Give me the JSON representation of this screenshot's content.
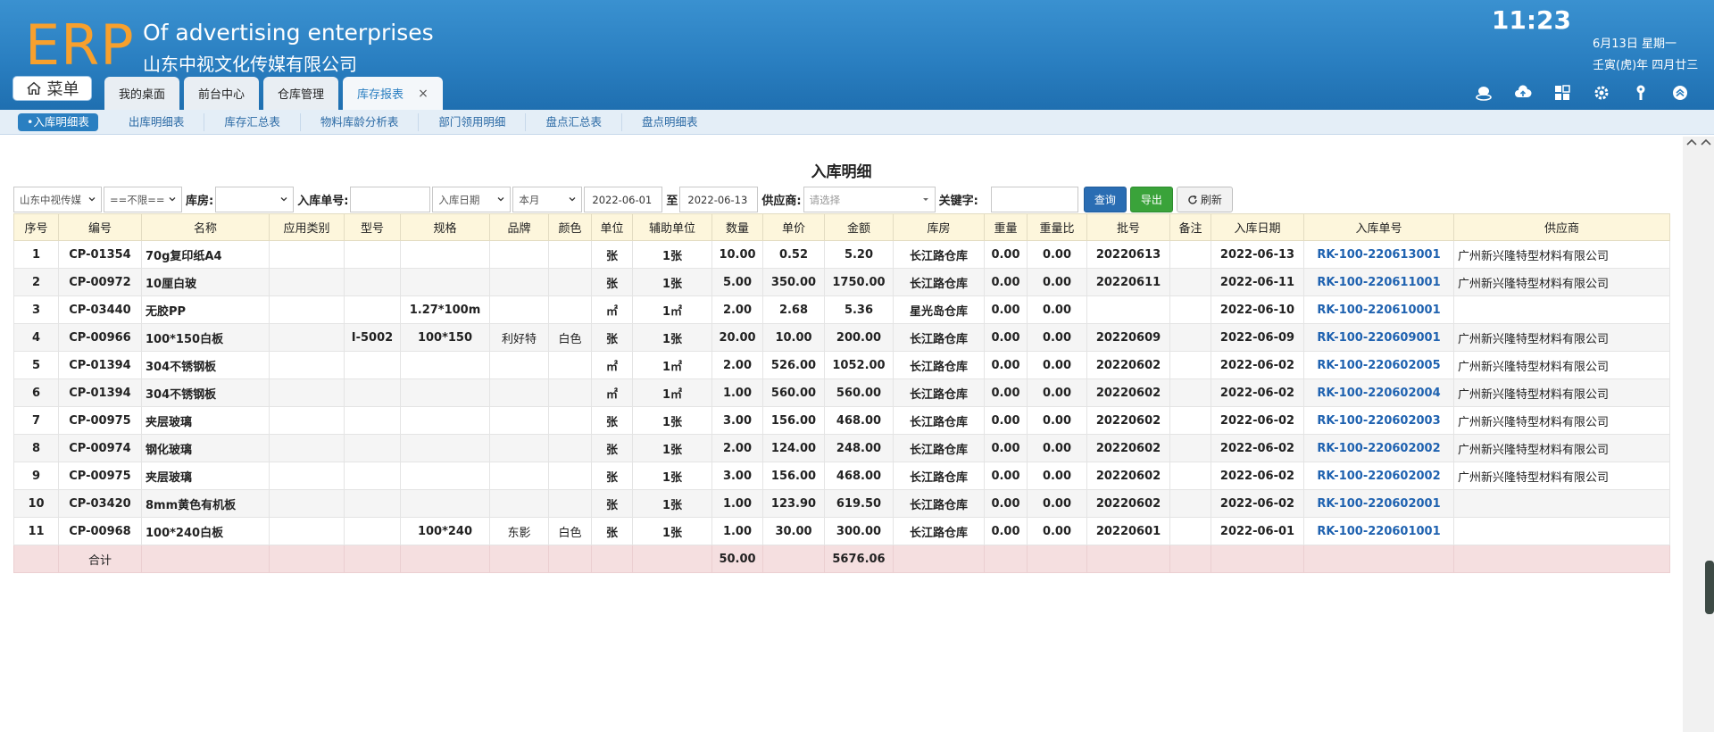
{
  "header": {
    "logo": "ERP",
    "brand_en": "Of advertising enterprises",
    "brand_cn": "山东中视文化传媒有限公司",
    "time": "11:23",
    "date_line1": "6月13日 星期一",
    "date_line2": "壬寅(虎)年 四月廿三",
    "menu_label": "菜单"
  },
  "tabs": [
    {
      "label": "我的桌面"
    },
    {
      "label": "前台中心"
    },
    {
      "label": "仓库管理"
    },
    {
      "label": "库存报表",
      "close": "×"
    }
  ],
  "subnav": [
    {
      "label": "•入库明细表"
    },
    {
      "label": "出库明细表"
    },
    {
      "label": "库存汇总表"
    },
    {
      "label": "物料库龄分析表"
    },
    {
      "label": "部门领用明细"
    },
    {
      "label": "盘点汇总表"
    },
    {
      "label": "盘点明细表"
    }
  ],
  "page_title": "入库明细",
  "filters": {
    "company": "山东中视传媒",
    "limit": "==不限==",
    "warehouse_label": "库房:",
    "warehouse_value": "",
    "order_no_label": "入库单号:",
    "order_no_value": "",
    "date_type": "入库日期",
    "period": "本月",
    "date_from": "2022-06-01",
    "to_label": "至",
    "date_to": "2022-06-13",
    "supplier_label": "供应商:",
    "supplier_placeholder": "请选择",
    "keyword_label": "关键字:",
    "keyword_value": "",
    "query_btn": "查询",
    "export_btn": "导出",
    "refresh_btn": "刷新"
  },
  "table": {
    "headers": [
      "序号",
      "编号",
      "名称",
      "应用类别",
      "型号",
      "规格",
      "品牌",
      "颜色",
      "单位",
      "辅助单位",
      "数量",
      "单价",
      "金额",
      "库房",
      "重量",
      "重量比",
      "批号",
      "备注",
      "入库日期",
      "入库单号",
      "供应商"
    ],
    "rows": [
      [
        "1",
        "CP-01354",
        "70g复印纸A4",
        "",
        "",
        "",
        "",
        "",
        "张",
        "1张",
        "10.00",
        "0.52",
        "5.20",
        "长江路仓库",
        "0.00",
        "0.00",
        "20220613",
        "",
        "2022-06-13",
        "RK-100-220613001",
        "广州新兴隆特型材料有限公司"
      ],
      [
        "2",
        "CP-00972",
        "10厘白玻",
        "",
        "",
        "",
        "",
        "",
        "张",
        "1张",
        "5.00",
        "350.00",
        "1750.00",
        "长江路仓库",
        "0.00",
        "0.00",
        "20220611",
        "",
        "2022-06-11",
        "RK-100-220611001",
        "广州新兴隆特型材料有限公司"
      ],
      [
        "3",
        "CP-03440",
        "无胶PP",
        "",
        "",
        "1.27*100m",
        "",
        "",
        "㎡",
        "1㎡",
        "2.00",
        "2.68",
        "5.36",
        "星光岛仓库",
        "0.00",
        "0.00",
        "",
        "",
        "2022-06-10",
        "RK-100-220610001",
        ""
      ],
      [
        "4",
        "CP-00966",
        "100*150白板",
        "",
        "I-5002",
        "100*150",
        "利好特",
        "白色",
        "张",
        "1张",
        "20.00",
        "10.00",
        "200.00",
        "长江路仓库",
        "0.00",
        "0.00",
        "20220609",
        "",
        "2022-06-09",
        "RK-100-220609001",
        "广州新兴隆特型材料有限公司"
      ],
      [
        "5",
        "CP-01394",
        "304不锈钢板",
        "",
        "",
        "",
        "",
        "",
        "㎡",
        "1㎡",
        "2.00",
        "526.00",
        "1052.00",
        "长江路仓库",
        "0.00",
        "0.00",
        "20220602",
        "",
        "2022-06-02",
        "RK-100-220602005",
        "广州新兴隆特型材料有限公司"
      ],
      [
        "6",
        "CP-01394",
        "304不锈钢板",
        "",
        "",
        "",
        "",
        "",
        "㎡",
        "1㎡",
        "1.00",
        "560.00",
        "560.00",
        "长江路仓库",
        "0.00",
        "0.00",
        "20220602",
        "",
        "2022-06-02",
        "RK-100-220602004",
        "广州新兴隆特型材料有限公司"
      ],
      [
        "7",
        "CP-00975",
        "夹层玻璃",
        "",
        "",
        "",
        "",
        "",
        "张",
        "1张",
        "3.00",
        "156.00",
        "468.00",
        "长江路仓库",
        "0.00",
        "0.00",
        "20220602",
        "",
        "2022-06-02",
        "RK-100-220602003",
        "广州新兴隆特型材料有限公司"
      ],
      [
        "8",
        "CP-00974",
        "钢化玻璃",
        "",
        "",
        "",
        "",
        "",
        "张",
        "1张",
        "2.00",
        "124.00",
        "248.00",
        "长江路仓库",
        "0.00",
        "0.00",
        "20220602",
        "",
        "2022-06-02",
        "RK-100-220602002",
        "广州新兴隆特型材料有限公司"
      ],
      [
        "9",
        "CP-00975",
        "夹层玻璃",
        "",
        "",
        "",
        "",
        "",
        "张",
        "1张",
        "3.00",
        "156.00",
        "468.00",
        "长江路仓库",
        "0.00",
        "0.00",
        "20220602",
        "",
        "2022-06-02",
        "RK-100-220602002",
        "广州新兴隆特型材料有限公司"
      ],
      [
        "10",
        "CP-03420",
        "8mm黄色有机板",
        "",
        "",
        "",
        "",
        "",
        "张",
        "1张",
        "1.00",
        "123.90",
        "619.50",
        "长江路仓库",
        "0.00",
        "0.00",
        "20220602",
        "",
        "2022-06-02",
        "RK-100-220602001",
        ""
      ],
      [
        "11",
        "CP-00968",
        "100*240白板",
        "",
        "",
        "100*240",
        "东影",
        "白色",
        "张",
        "1张",
        "1.00",
        "30.00",
        "300.00",
        "长江路仓库",
        "0.00",
        "0.00",
        "20220601",
        "",
        "2022-06-01",
        "RK-100-220601001",
        ""
      ]
    ],
    "footer": {
      "label": "合计",
      "qty_total": "50.00",
      "amount_total": "5676.06"
    }
  },
  "colors": {
    "header_blue": "#2a7fc1",
    "logo_orange": "#f7a02d",
    "link_blue": "#1f62b0",
    "table_header_bg": "#fdf6dc",
    "total_row_bg": "#f5dfe0"
  }
}
